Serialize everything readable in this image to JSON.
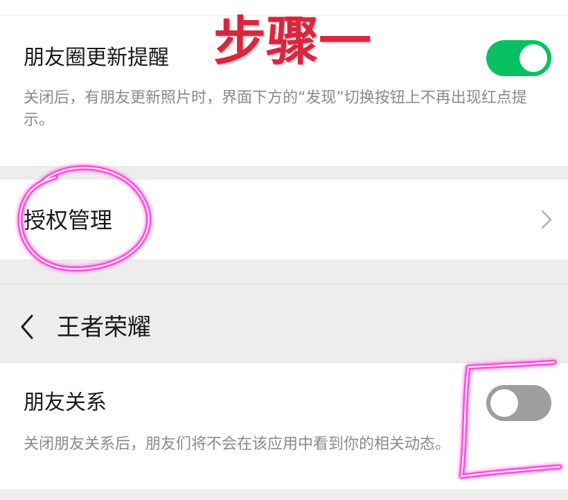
{
  "annotation": {
    "step_label": "步骤一"
  },
  "moments_update": {
    "label": "朋友圈更新提醒",
    "description": "关闭后，有朋友更新照片时，界面下方的“发现”切换按钮上不再出现红点提示。",
    "enabled": true
  },
  "auth_management": {
    "label": "授权管理",
    "icon": "chevron-right-icon"
  },
  "navbar": {
    "back_icon": "chevron-left-icon",
    "title": "王者荣耀"
  },
  "friend_relation": {
    "label": "朋友关系",
    "description": "关闭朋友关系后，朋友们将不会在该应用中看到你的相关动态。",
    "enabled": false
  },
  "colors": {
    "toggle_on": "#07c160",
    "toggle_off": "#9e9e9e",
    "annotation_text": "#d9263f",
    "highlight_stroke": "#ff3fd8"
  }
}
